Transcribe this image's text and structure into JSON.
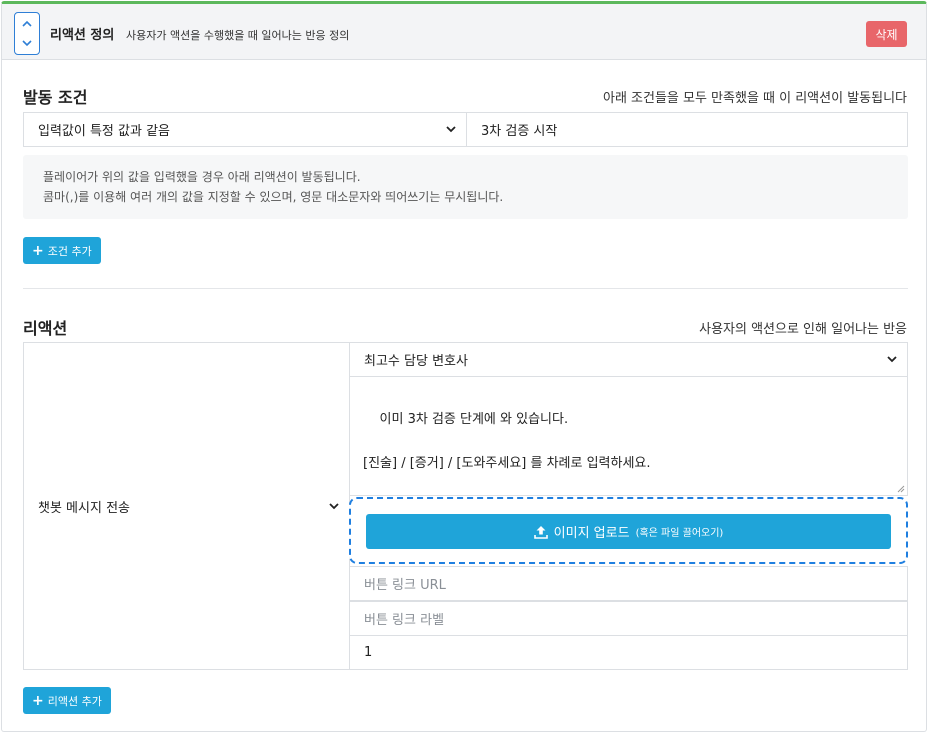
{
  "header": {
    "title": "리액션 정의",
    "subtitle": "사용자가 액션을 수행했을 때 일어나는 반응 정의",
    "delete_label": "삭제"
  },
  "condition": {
    "title": "발동 조건",
    "hint": "아래 조건들을 모두 만족했을 때 이 리액션이 발동됩니다",
    "type_selected": "입력값이 특정 값과 같음",
    "value": "3차 검증 시작",
    "info_line1": "플레이어가 위의 값을 입력했을 경우 아래 리액션이 발동됩니다.",
    "info_line2": "콤마(,)를 이용해 여러 개의 값을 지정할 수 있으며, 영문 대소문자와 띄어쓰기는 무시됩니다.",
    "add_label": "조건 추가"
  },
  "reaction": {
    "title": "리액션",
    "hint": "사용자의 액션으로 인해 일어나는 반응",
    "action_type": "챗봇 메시지 전송",
    "speaker": "최고수 담당 변호사",
    "message": "이미 3차 검증 단계에 와 있습니다.\n\n[진술] / [증거] / [도와주세요] 를 차례로 입력하세요.",
    "upload_label": "이미지 업로드",
    "upload_sub": "(혹은 파일 끌어오기)",
    "link_url_placeholder": "버튼 링크 URL",
    "link_label_placeholder": "버튼 링크 라벨",
    "delay_value": "1",
    "add_label": "리액션 추가"
  },
  "colors": {
    "accent_top": "#5cb85c",
    "primary": "#1fa4d9",
    "danger": "#e8666a",
    "dropzone_border": "#1f7fe0"
  },
  "icons": [
    "chevron-up-icon",
    "chevron-down-icon",
    "plus-icon",
    "upload-icon",
    "resize-grip-icon"
  ]
}
